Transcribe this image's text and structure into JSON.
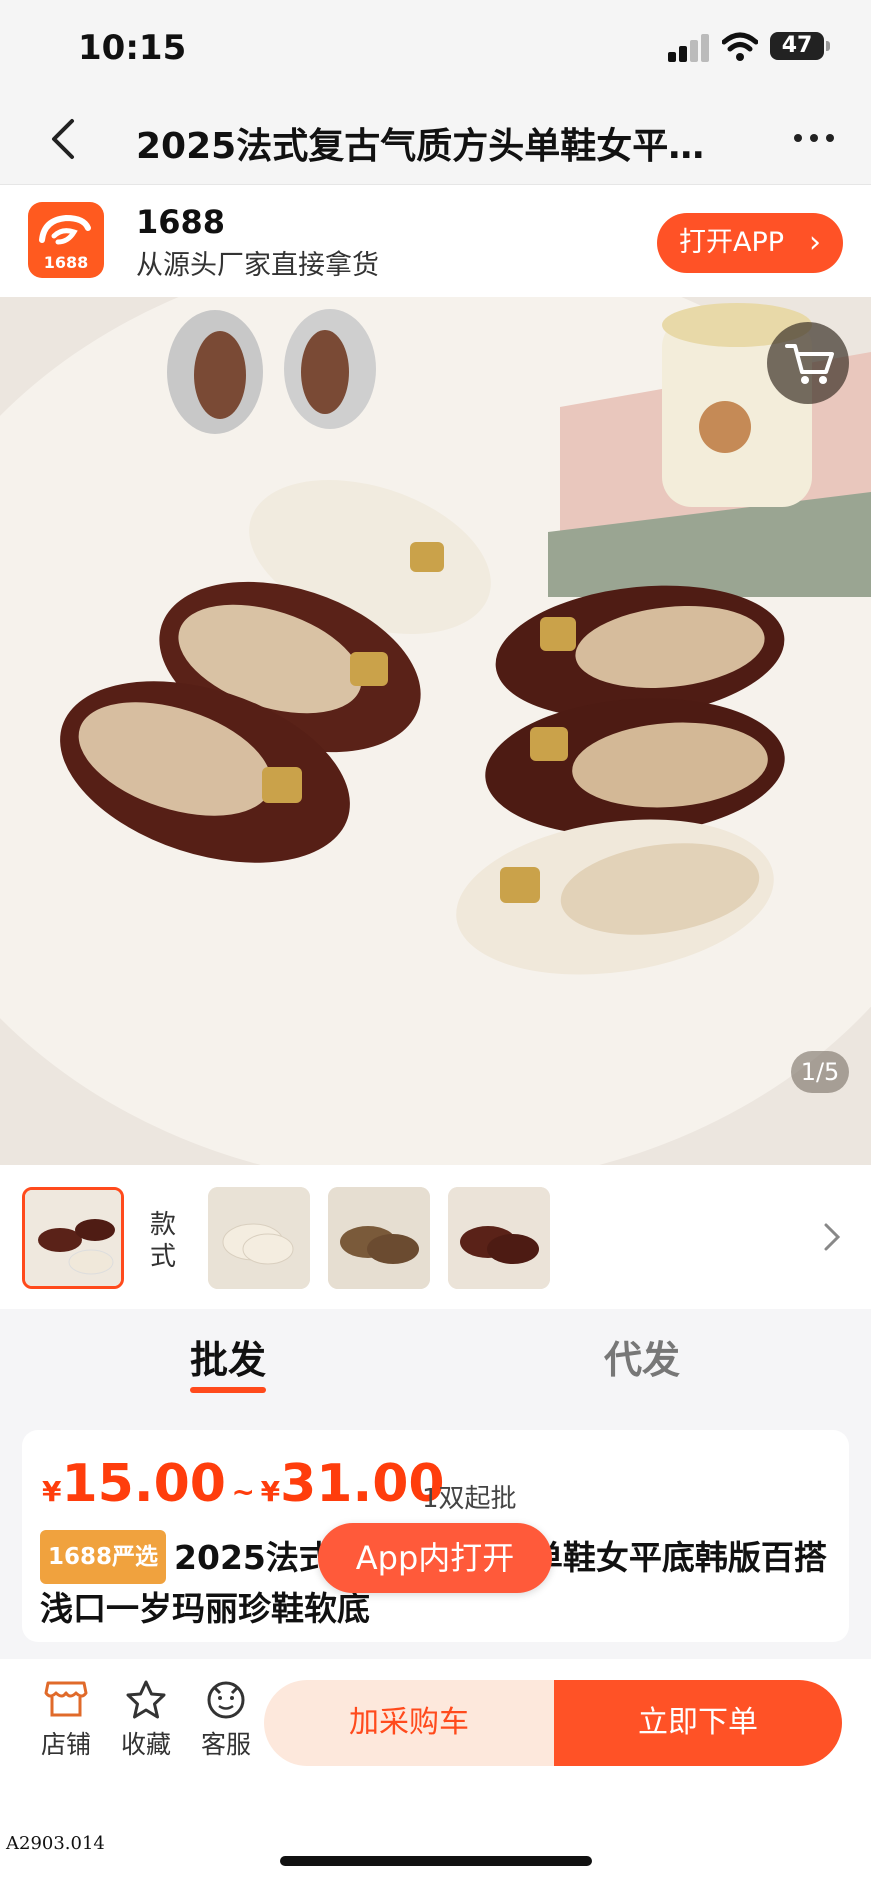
{
  "status": {
    "time": "10:15",
    "battery": "47"
  },
  "nav": {
    "title": "2025法式复古气质方头单鞋女平…"
  },
  "banner": {
    "brand": "1688",
    "logo_text": "1688",
    "slogan": "从源头厂家直接拿货",
    "open_app": "打开APP"
  },
  "gallery": {
    "pager": "1/5"
  },
  "thumbs": {
    "style_label": "款式"
  },
  "tabs": [
    {
      "label": "批发"
    },
    {
      "label": "代发"
    }
  ],
  "product": {
    "currency": "¥",
    "price_low": "15.00",
    "tilde": "~",
    "price_high": "31.00",
    "min_qty": "1双起批",
    "tag": "1688严选",
    "title": "2025法式复古气质方头单鞋女平底韩版百搭浅口一岁玛丽珍鞋软底"
  },
  "float_button": "App内打开",
  "bottom": {
    "shop": "店铺",
    "favorite": "收藏",
    "service": "客服",
    "add_cart": "加采购车",
    "buy_now": "立即下单"
  },
  "watermark": "A2903.014",
  "colors": {
    "accent": "#ff5226",
    "price": "#ff3d0c",
    "tag": "#f0a23e"
  }
}
